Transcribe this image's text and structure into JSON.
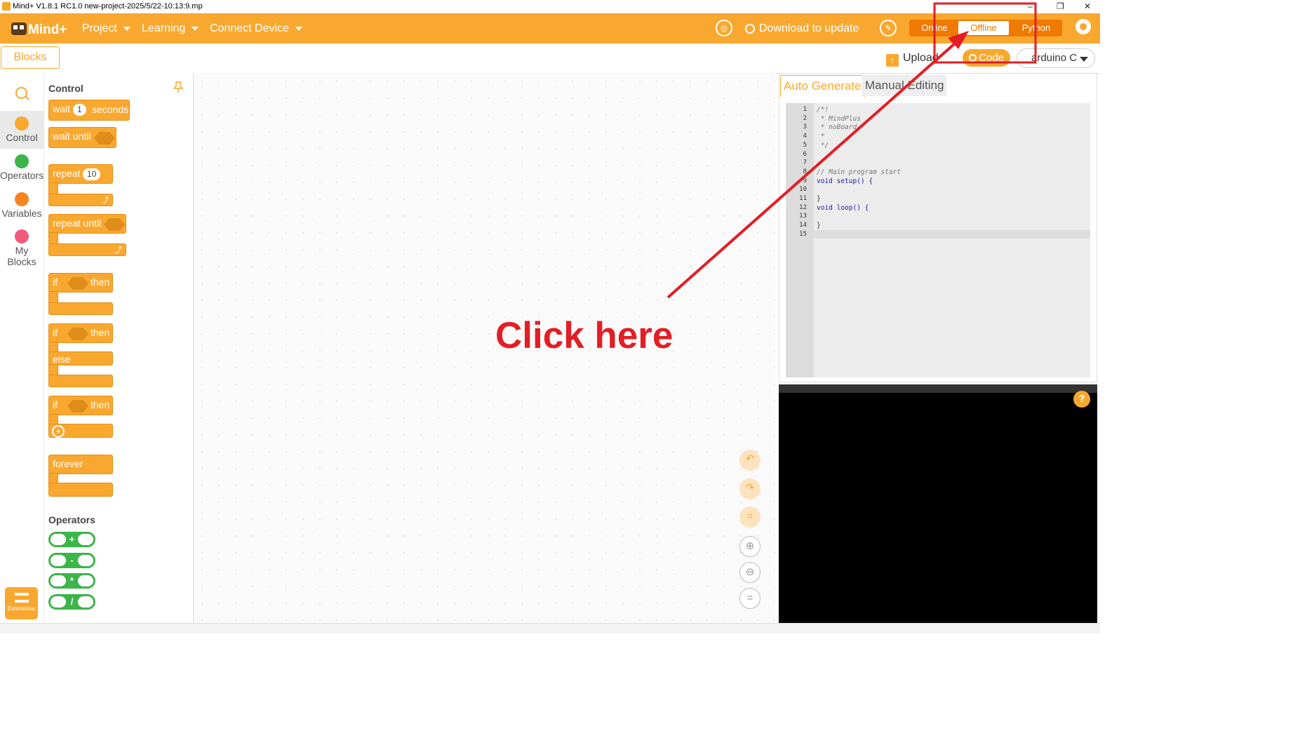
{
  "window": {
    "title": "Mind+ V1.8.1 RC1.0   new-project-2025/5/22-10:13:9.mp",
    "minimize": "–",
    "restore": "❐",
    "close": "✕"
  },
  "header": {
    "logo_text": "Mind+",
    "menus": [
      "Project",
      "Learning",
      "Connect Device"
    ],
    "update_label": "Download to update",
    "modes": [
      "Online",
      "Offline",
      "Python"
    ],
    "active_mode": "Offline",
    "accent_color": "#f9a82f"
  },
  "toolbar": {
    "blocks_tab": "Blocks",
    "upload_label": "Upload",
    "code_label": "Code",
    "board": "arduino C"
  },
  "categories": [
    {
      "label": "Control",
      "color": "#f9a82f",
      "selected": true
    },
    {
      "label": "Operators",
      "color": "#3cb54a",
      "selected": false
    },
    {
      "label": "Variables",
      "color": "#f7841e",
      "selected": false
    },
    {
      "label": "My Blocks",
      "color": "#f25a7c",
      "selected": false
    }
  ],
  "extensions_label": "Extensions",
  "flyout": {
    "control_title": "Control",
    "operators_title": "Operators",
    "blocks": {
      "wait": "wait",
      "wait_value": "1",
      "seconds": "seconds",
      "wait_until": "wait until",
      "repeat": "repeat",
      "repeat_value": "10",
      "repeat_until": "repeat until",
      "if": "if",
      "then": "then",
      "else": "else",
      "forever": "forever"
    },
    "operators": [
      "+",
      "-",
      "*",
      "/"
    ]
  },
  "code_panel": {
    "tabs": [
      "Auto Generate",
      "Manual Editing"
    ],
    "active_tab": "Auto Generate",
    "lines": [
      {
        "n": "1",
        "text": "/*!",
        "type": "comment"
      },
      {
        "n": "2",
        "text": " * MindPlus",
        "type": "comment"
      },
      {
        "n": "3",
        "text": " * noBoard",
        "type": "comment"
      },
      {
        "n": "4",
        "text": " *",
        "type": "comment"
      },
      {
        "n": "5",
        "text": " */",
        "type": "comment"
      },
      {
        "n": "6",
        "text": "",
        "type": "plain"
      },
      {
        "n": "7",
        "text": "",
        "type": "plain"
      },
      {
        "n": "8",
        "text": "// Main program start",
        "type": "comment"
      },
      {
        "n": "9",
        "text": "void setup() {",
        "type": "code"
      },
      {
        "n": "10",
        "text": "",
        "type": "plain"
      },
      {
        "n": "11",
        "text": "}",
        "type": "plain"
      },
      {
        "n": "12",
        "text": "void loop() {",
        "type": "code"
      },
      {
        "n": "13",
        "text": "",
        "type": "plain"
      },
      {
        "n": "14",
        "text": "}",
        "type": "plain"
      },
      {
        "n": "15",
        "text": "",
        "type": "plain"
      }
    ]
  },
  "help_label": "?",
  "annotation": {
    "text": "Click here",
    "color": "#e31e24"
  }
}
